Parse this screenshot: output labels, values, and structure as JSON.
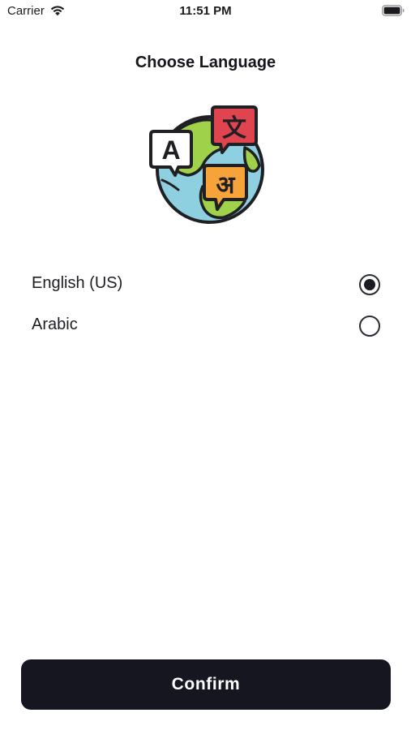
{
  "status_bar": {
    "carrier": "Carrier",
    "time": "11:51 PM",
    "icons": [
      "wifi-icon",
      "battery-icon"
    ]
  },
  "title": "Choose Language",
  "illustration": {
    "icon": "globe-translate-icon",
    "glyphs": {
      "latin": "A",
      "chinese": "文",
      "hindi": "अ"
    }
  },
  "languages": [
    {
      "label": "English (US)",
      "selected": true
    },
    {
      "label": "Arabic",
      "selected": false
    }
  ],
  "confirm_label": "Confirm",
  "colors": {
    "primary": "#15161f",
    "text": "#15161c",
    "background": "#ffffff"
  }
}
